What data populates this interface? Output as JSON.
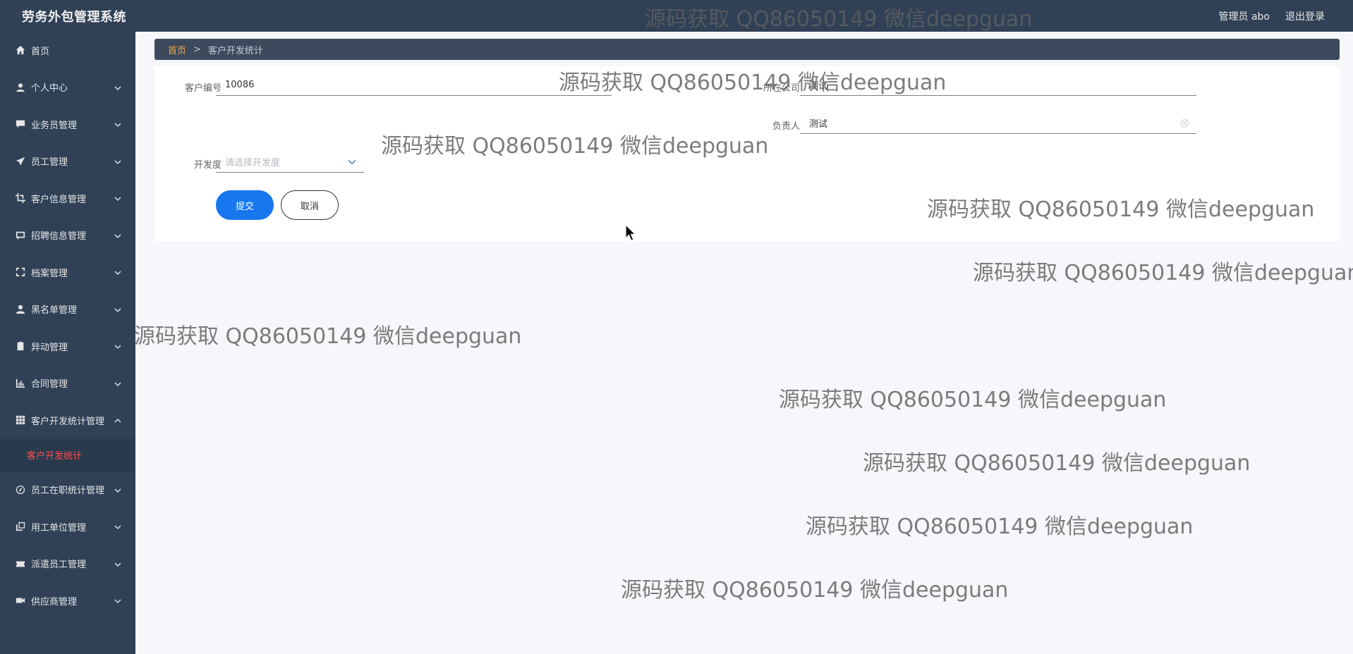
{
  "header": {
    "app_title": "劳务外包管理系统",
    "user_label": "管理员 abo",
    "logout_label": "退出登录"
  },
  "sidebar": {
    "items": [
      {
        "label": "首页",
        "icon": "home-icon",
        "has_chevron": false
      },
      {
        "label": "个人中心",
        "icon": "user-icon",
        "has_chevron": true
      },
      {
        "label": "业务员管理",
        "icon": "chat-icon",
        "has_chevron": true
      },
      {
        "label": "员工管理",
        "icon": "send-icon",
        "has_chevron": true
      },
      {
        "label": "客户信息管理",
        "icon": "crop-icon",
        "has_chevron": true
      },
      {
        "label": "招聘信息管理",
        "icon": "message-icon",
        "has_chevron": true
      },
      {
        "label": "档案管理",
        "icon": "fullscreen-icon",
        "has_chevron": true
      },
      {
        "label": "黑名单管理",
        "icon": "person-icon",
        "has_chevron": true
      },
      {
        "label": "异动管理",
        "icon": "clipboard-icon",
        "has_chevron": true
      },
      {
        "label": "合同管理",
        "icon": "chart-icon",
        "has_chevron": true
      },
      {
        "label": "客户开发统计管理",
        "icon": "grid-icon",
        "has_chevron": true,
        "expanded": true
      }
    ],
    "active_sub": "客户开发统计",
    "items_after": [
      {
        "label": "员工在职统计管理",
        "icon": "compass-icon",
        "has_chevron": true
      },
      {
        "label": "用工单位管理",
        "icon": "copy-icon",
        "has_chevron": true
      },
      {
        "label": "派遣员工管理",
        "icon": "ticket-icon",
        "has_chevron": true
      },
      {
        "label": "供应商管理",
        "icon": "camera-icon",
        "has_chevron": true
      }
    ]
  },
  "breadcrumb": {
    "home": "首页",
    "separator": ">",
    "current": "客户开发统计"
  },
  "form": {
    "customer_no_label": "客户编号",
    "customer_no_value": "10086",
    "company_label": "所在公司",
    "company_value": "测试",
    "owner_label": "负责人",
    "owner_value": "测试",
    "dev_label": "开发度",
    "dev_placeholder": "请选择开发度",
    "submit_label": "提交",
    "cancel_label": "取消"
  },
  "watermark_text": "源码获取 QQ86050149 微信deepguan",
  "colors": {
    "sidebar_bg": "#304156",
    "accent_orange": "#f0a64a",
    "active_red": "#ff4d4f",
    "primary_blue": "#1677ee"
  }
}
